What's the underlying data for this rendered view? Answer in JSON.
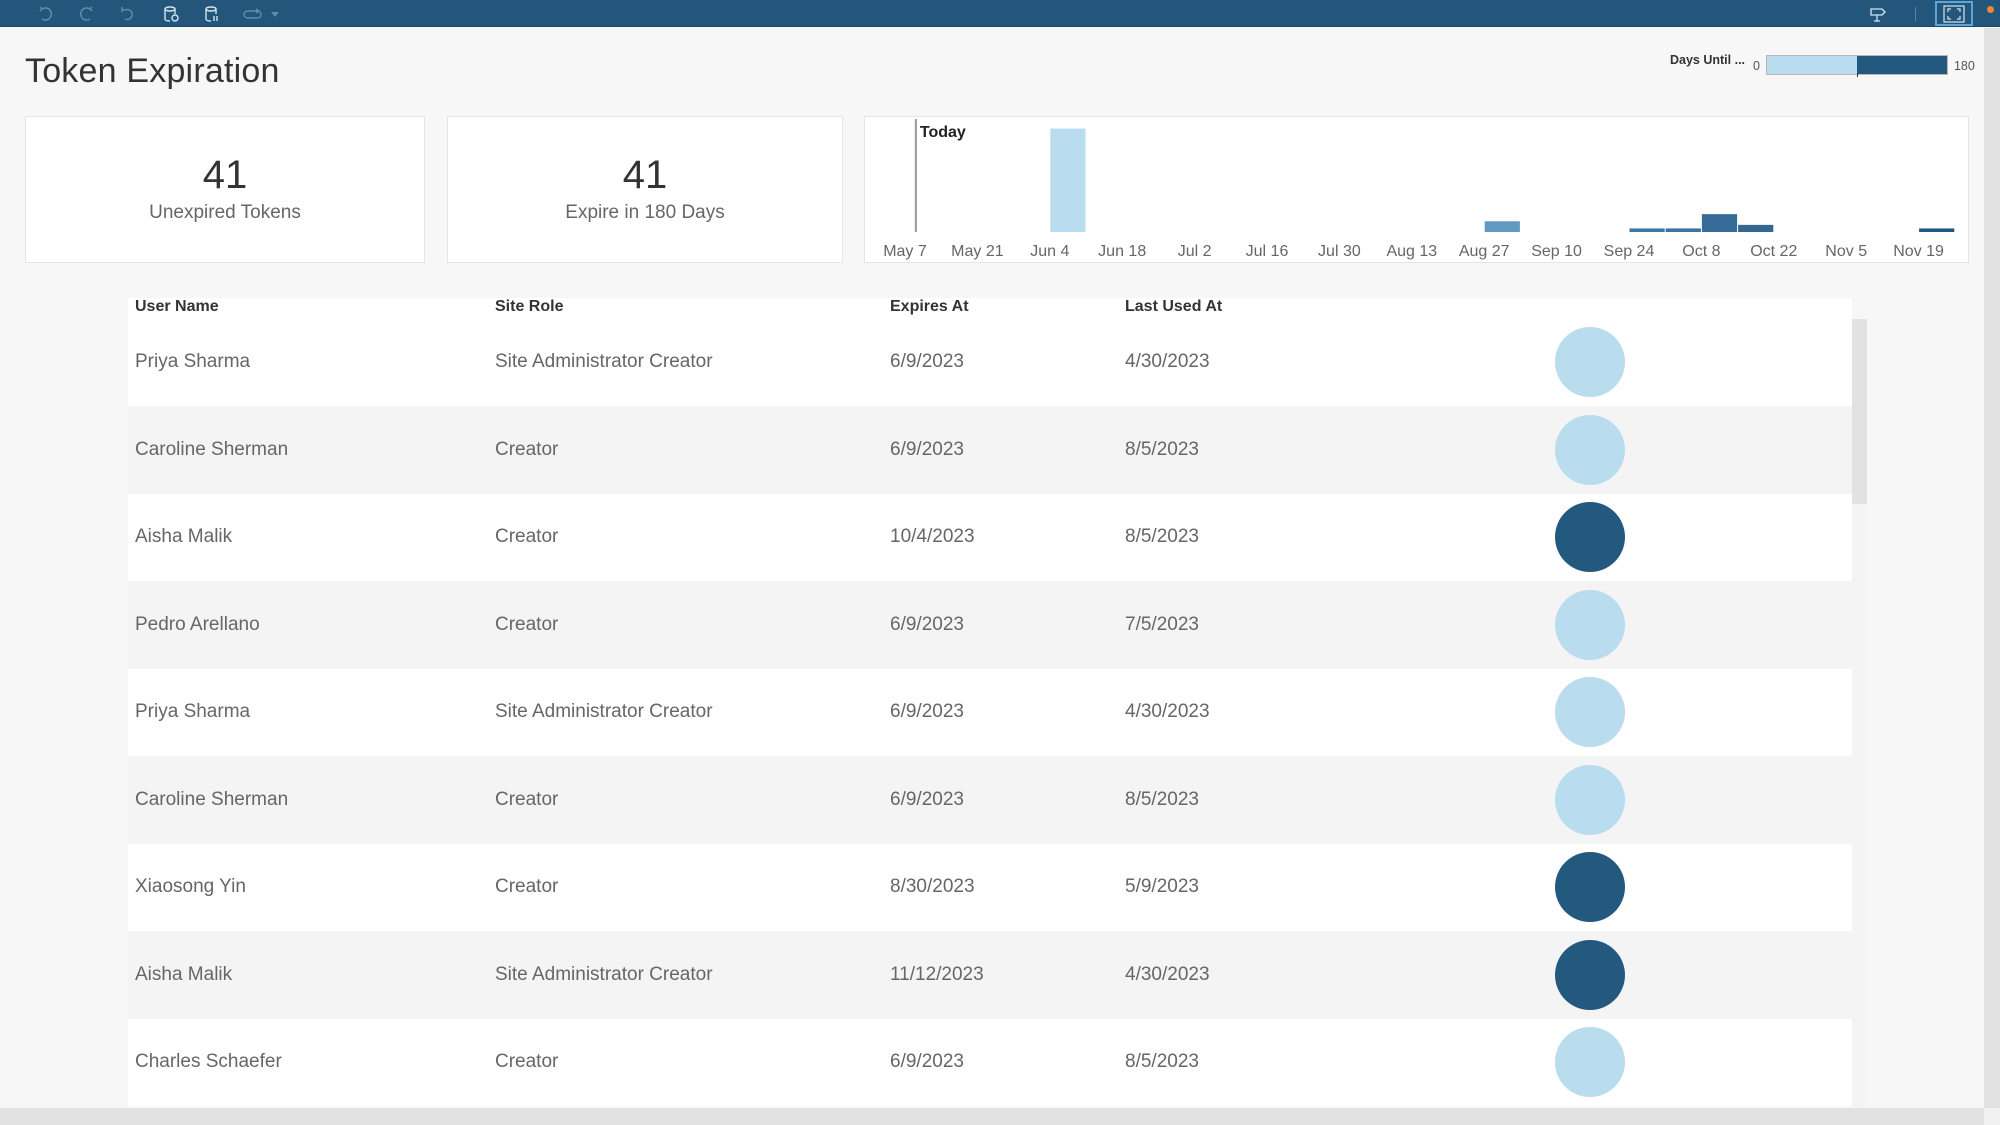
{
  "toolbar": {
    "buttons": [
      {
        "name": "undo",
        "icon": "undo-icon"
      },
      {
        "name": "redo",
        "icon": "redo-icon"
      },
      {
        "name": "revert",
        "icon": "revert-icon"
      },
      {
        "name": "refresh-data",
        "icon": "database-refresh-icon"
      },
      {
        "name": "pause-updates",
        "icon": "database-pause-icon"
      },
      {
        "name": "device-preview",
        "icon": "device-icon"
      },
      {
        "name": "more",
        "icon": "caret-down-icon"
      }
    ],
    "right_buttons": [
      {
        "name": "guide",
        "icon": "signpost-icon"
      },
      {
        "name": "presentation-mode",
        "icon": "fullscreen-icon"
      }
    ],
    "colors": {
      "background": "#23567a",
      "icon": "#7fa8c6",
      "active": "#d6e4ee"
    }
  },
  "title": "Token Expiration",
  "legend": {
    "title": "Days Until ...",
    "min": "0",
    "max": "180",
    "split_fraction": 0.5,
    "colors": {
      "low": "#b9dcee",
      "high": "#23587f"
    }
  },
  "kpis": [
    {
      "value": "41",
      "label": "Unexpired Tokens"
    },
    {
      "value": "41",
      "label": "Expire in 180 Days"
    }
  ],
  "chart_data": {
    "type": "bar",
    "title": "",
    "xlabel": "",
    "ylabel": "",
    "x_ticks": [
      "May 7",
      "May 21",
      "Jun 4",
      "Jun 18",
      "Jul 2",
      "Jul 16",
      "Jul 30",
      "Aug 13",
      "Aug 27",
      "Sep 10",
      "Sep 24",
      "Oct 8",
      "Oct 22",
      "Nov 5",
      "Nov 19"
    ],
    "bin": "week",
    "x_start": "May 7",
    "annotation": {
      "label": "Today",
      "week_offset": 0.3
    },
    "bars": [
      {
        "week": "Jun 4",
        "week_index": 4,
        "value": 29,
        "color": "#b9dcee"
      },
      {
        "week": "Aug 27",
        "week_index": 16,
        "value": 3,
        "color": "#6199c0"
      },
      {
        "week": "Sep 24",
        "week_index": 20,
        "value": 1,
        "color": "#3f77a3"
      },
      {
        "week": "Oct 1",
        "week_index": 21,
        "value": 1,
        "color": "#3c73a0"
      },
      {
        "week": "Oct 8",
        "week_index": 22,
        "value": 5,
        "color": "#366b98"
      },
      {
        "week": "Oct 15",
        "week_index": 23,
        "value": 2,
        "color": "#33678f"
      },
      {
        "week": "Nov 19",
        "week_index": 28,
        "value": 1,
        "color": "#23587f"
      }
    ],
    "ylim": [
      0,
      30
    ],
    "grid": false
  },
  "table": {
    "columns": [
      "User Name",
      "Site Role",
      "Expires At",
      "Last Used At"
    ],
    "rows": [
      {
        "user": "Priya Sharma",
        "role": "Site Administrator Creator",
        "expires": "6/9/2023",
        "last_used": "4/30/2023",
        "dot": "light"
      },
      {
        "user": "Caroline Sherman",
        "role": "Creator",
        "expires": "6/9/2023",
        "last_used": "8/5/2023",
        "dot": "light"
      },
      {
        "user": "Aisha Malik",
        "role": "Creator",
        "expires": "10/4/2023",
        "last_used": "8/5/2023",
        "dot": "dark"
      },
      {
        "user": "Pedro Arellano",
        "role": "Creator",
        "expires": "6/9/2023",
        "last_used": "7/5/2023",
        "dot": "light"
      },
      {
        "user": "Priya Sharma",
        "role": "Site Administrator Creator",
        "expires": "6/9/2023",
        "last_used": "4/30/2023",
        "dot": "light"
      },
      {
        "user": "Caroline Sherman",
        "role": "Creator",
        "expires": "6/9/2023",
        "last_used": "8/5/2023",
        "dot": "light"
      },
      {
        "user": "Xiaosong Yin",
        "role": "Creator",
        "expires": "8/30/2023",
        "last_used": "5/9/2023",
        "dot": "dark"
      },
      {
        "user": "Aisha Malik",
        "role": "Site Administrator Creator",
        "expires": "11/12/2023",
        "last_used": "4/30/2023",
        "dot": "dark"
      },
      {
        "user": "Charles Schaefer",
        "role": "Creator",
        "expires": "6/9/2023",
        "last_used": "8/5/2023",
        "dot": "light"
      }
    ],
    "dot_colors": {
      "light": "#b9dcee",
      "dark": "#23587f"
    }
  }
}
